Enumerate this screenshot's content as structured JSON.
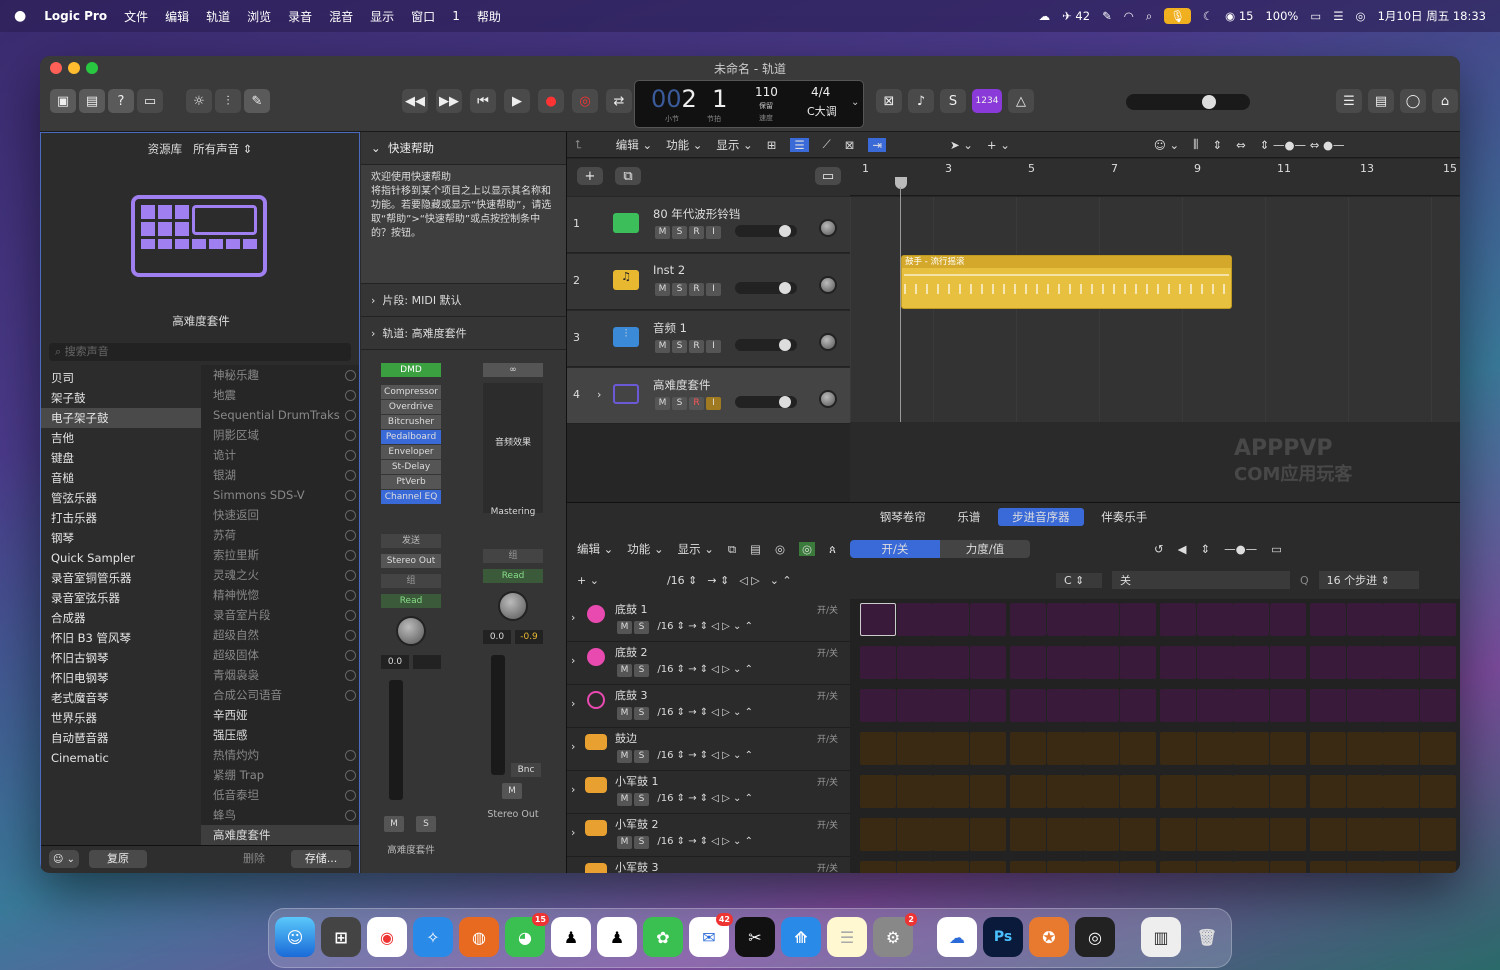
{
  "menubar": {
    "app": "Logic Pro",
    "items": [
      "文件",
      "编辑",
      "轨道",
      "浏览",
      "录音",
      "混音",
      "显示",
      "窗口",
      "1",
      "帮助"
    ],
    "clock": "1月10日 周五 18:33",
    "battery": "100%",
    "wechat_count": "15",
    "notif_count": "42"
  },
  "window": {
    "title": "未命名 - 轨道"
  },
  "lcd": {
    "bar": "2",
    "beat": "1",
    "bar_label": "小节",
    "beat_label": "节拍",
    "tempo": "110",
    "tempo_label": "保留",
    "tempo_sub": "速度",
    "sig": "4/4",
    "key": "C大调",
    "icon_label": "1234"
  },
  "library": {
    "header": "资源库",
    "filter": "所有声音",
    "preset_name": "高难度套件",
    "search_placeholder": "搜索声音",
    "categories": [
      "贝司",
      "架子鼓",
      "电子架子鼓",
      "吉他",
      "键盘",
      "音槌",
      "管弦乐器",
      "打击乐器",
      "钢琴",
      "Quick Sampler",
      "录音室铜管乐器",
      "录音室弦乐器",
      "合成器",
      "怀旧 B3 管风琴",
      "怀旧古钢琴",
      "怀旧电钢琴",
      "老式魔音琴",
      "世界乐器",
      "自动琶音器",
      "Cinematic"
    ],
    "subitems": [
      "神秘乐趣",
      "地震",
      "Sequential DrumTraks",
      "阴影区域",
      "诡计",
      "银湖",
      "Simmons SDS-V",
      "快速返回",
      "苏荷",
      "索拉里斯",
      "灵魂之火",
      "精神恍惚",
      "录音室片段",
      "超级自然",
      "超级固体",
      "青烟袅袅",
      "合成公司语音",
      "辛西娅",
      "强压感",
      "热情灼灼",
      "紧绷 Trap",
      "低音泰坦",
      "蜂鸟",
      "高难度套件"
    ],
    "btn_revert": "复原",
    "btn_delete": "删除",
    "btn_save": "存储..."
  },
  "quickhelp": {
    "title": "快速帮助",
    "heading": "欢迎使用快速帮助",
    "body": "将指针移到某个项目之上以显示其名称和功能。若要隐藏或显示“快速帮助”，请选取“帮助”>“快速帮助”或点按控制条中的？按钮。",
    "region_row": "片段: MIDI 默认",
    "track_row": "轨道: 高难度套件"
  },
  "inspector": {
    "dmd": "DMD",
    "plugins": [
      "Compressor",
      "Overdrive",
      "Bitcrusher",
      "Pedalboard",
      "Enveloper",
      "St-Delay",
      "PtVerb",
      "Channel EQ"
    ],
    "audio_fx": "音频效果",
    "mastering": "Mastering",
    "send": "发送",
    "output": "Stereo Out",
    "group": "组",
    "read": "Read",
    "vol1": "0.0",
    "vol2": "0.0",
    "pan2": "-0.9",
    "bnc": "Bnc",
    "m": "M",
    "s": "S",
    "ch1_name": "高难度套件",
    "ch2_name": "Stereo Out"
  },
  "tracks_toolbar": {
    "edit": "编辑",
    "func": "功能",
    "view": "显示"
  },
  "ruler": [
    "1",
    "3",
    "5",
    "7",
    "9",
    "11",
    "13",
    "15"
  ],
  "tracks": [
    {
      "num": "1",
      "name": "80 年代波形铃铛",
      "color": "#3cbf5a"
    },
    {
      "num": "2",
      "name": "Inst 2",
      "color": "#e8b830"
    },
    {
      "num": "3",
      "name": "音频 1",
      "color": "#3a8ad8"
    },
    {
      "num": "4",
      "name": "高难度套件",
      "color": "#6a5ad8"
    }
  ],
  "track_btns": {
    "m": "M",
    "s": "S",
    "r": "R",
    "i": "I"
  },
  "region": {
    "label": "鼓手 - 流行摇滚"
  },
  "watermark": {
    "line1": "APPPVP",
    "line2": "COM应用玩客"
  },
  "editor": {
    "tabs": [
      "钢琴卷帘",
      "乐谱",
      "步进音序器",
      "伴奏乐手"
    ],
    "active_tab": "步进音序器",
    "edit": "编辑",
    "func": "功能",
    "view": "显示",
    "onoff": "开/关",
    "velocity": "力度/值",
    "division": "/16",
    "key": "C",
    "scale": "关",
    "steps": "16 个步进",
    "q": "Q",
    "rows": [
      {
        "name": "底鼓 1",
        "state": "开/关"
      },
      {
        "name": "底鼓 2",
        "state": "开/关"
      },
      {
        "name": "底鼓 3",
        "state": "开/关"
      },
      {
        "name": "鼓边",
        "state": "开/关"
      },
      {
        "name": "小军鼓 1",
        "state": "开/关"
      },
      {
        "name": "小军鼓 2",
        "state": "开/关"
      },
      {
        "name": "小军鼓 3",
        "state": "开/关"
      }
    ],
    "row_division": "/16",
    "m": "M",
    "s": "S"
  },
  "dock": {
    "wechat_badge": "15",
    "mail_badge": "42",
    "settings_badge": "2"
  }
}
